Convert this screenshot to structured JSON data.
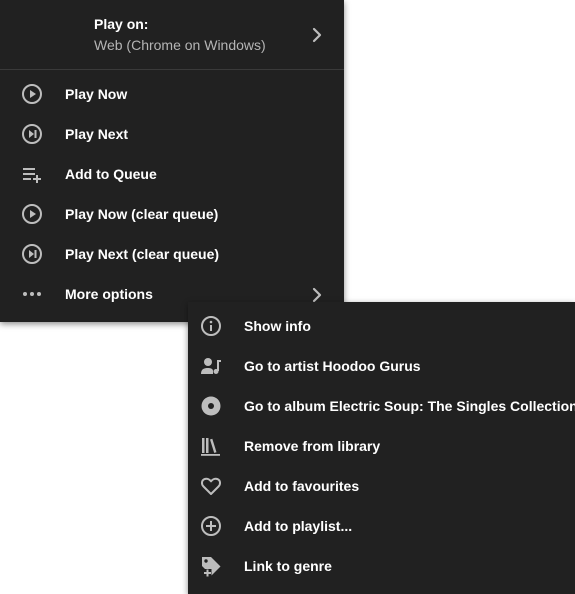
{
  "main_menu": {
    "play_on": {
      "title": "Play on:",
      "device": "Web (Chrome on Windows)",
      "icon": "chevron-right-icon"
    },
    "items": [
      {
        "label": "Play Now",
        "icon": "play-circle-icon"
      },
      {
        "label": "Play Next",
        "icon": "skip-next-circle-icon"
      },
      {
        "label": "Add to Queue",
        "icon": "playlist-add-icon"
      },
      {
        "label": "Play Now (clear queue)",
        "icon": "play-circle-icon"
      },
      {
        "label": "Play Next (clear queue)",
        "icon": "skip-next-circle-icon"
      },
      {
        "label": "More options",
        "icon": "dots-horizontal-icon"
      }
    ]
  },
  "sub_menu": {
    "items": [
      {
        "label": "Show info",
        "icon": "info-circle-icon"
      },
      {
        "label": "Go to artist Hoodoo Gurus",
        "icon": "account-music-icon"
      },
      {
        "label": "Go to album Electric Soup: The Singles Collection",
        "icon": "album-icon"
      },
      {
        "label": "Remove from library",
        "icon": "library-icon"
      },
      {
        "label": "Add to favourites",
        "icon": "heart-outline-icon"
      },
      {
        "label": "Add to playlist...",
        "icon": "plus-circle-icon"
      },
      {
        "label": "Link to genre",
        "icon": "tag-plus-icon"
      }
    ]
  },
  "colors": {
    "menu_background": "#212121",
    "text": "#ffffff",
    "secondary_text": "#b5b5b5",
    "icon": "#bdbdbd",
    "page_background": "#ffffff"
  }
}
